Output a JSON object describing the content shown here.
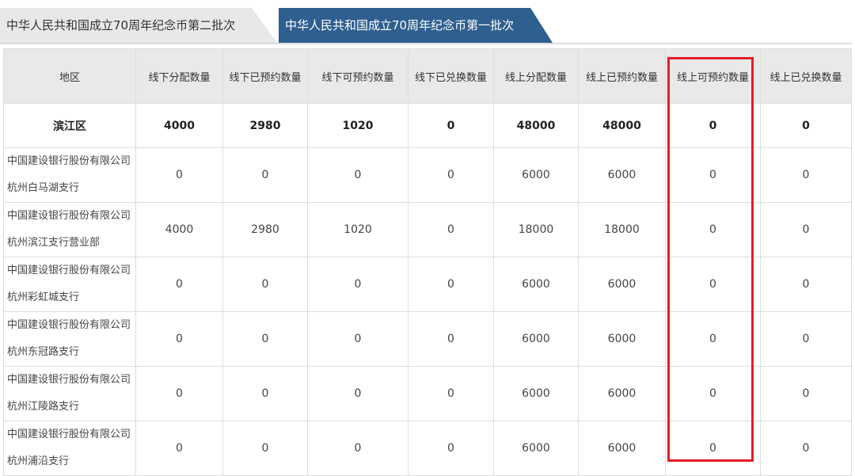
{
  "tabs": [
    {
      "label": "中华人民共和国成立70周年纪念币第二批次",
      "active": false
    },
    {
      "label": "中华人民共和国成立70周年纪念币第一批次",
      "active": true
    }
  ],
  "table": {
    "headers": [
      "地区",
      "线下分配数量",
      "线下已预约数量",
      "线下可预约数量",
      "线下已兑换数量",
      "线上分配数量",
      "线上已预约数量",
      "线上可预约数量",
      "线上已兑换数量"
    ],
    "total_row": [
      "滨江区",
      "4000",
      "2980",
      "1020",
      "0",
      "48000",
      "48000",
      "0",
      "0"
    ],
    "rows": [
      {
        "region": [
          "中国建设银行股份有限公司",
          "杭州白马湖支行"
        ],
        "values": [
          "0",
          "0",
          "0",
          "0",
          "6000",
          "6000",
          "0",
          "0"
        ]
      },
      {
        "region": [
          "中国建设银行股份有限公司",
          "杭州滨江支行营业部"
        ],
        "values": [
          "4000",
          "2980",
          "1020",
          "0",
          "18000",
          "18000",
          "0",
          "0"
        ]
      },
      {
        "region": [
          "中国建设银行股份有限公司",
          "杭州彩虹城支行"
        ],
        "values": [
          "0",
          "0",
          "0",
          "0",
          "6000",
          "6000",
          "0",
          "0"
        ]
      },
      {
        "region": [
          "中国建设银行股份有限公司",
          "杭州东冠路支行"
        ],
        "values": [
          "0",
          "0",
          "0",
          "0",
          "6000",
          "6000",
          "0",
          "0"
        ]
      },
      {
        "region": [
          "中国建设银行股份有限公司",
          "杭州江陵路支行"
        ],
        "values": [
          "0",
          "0",
          "0",
          "0",
          "6000",
          "6000",
          "0",
          "0"
        ]
      },
      {
        "region": [
          "中国建设银行股份有限公司",
          "杭州浦沿支行"
        ],
        "values": [
          "0",
          "0",
          "0",
          "0",
          "6000",
          "6000",
          "0",
          "0"
        ]
      }
    ]
  },
  "highlight": {
    "column": "线上可预约数量",
    "color": "#e21f26"
  },
  "colors": {
    "active_tab": "#2e5f8f",
    "header_bg": "#e9e9e9"
  }
}
